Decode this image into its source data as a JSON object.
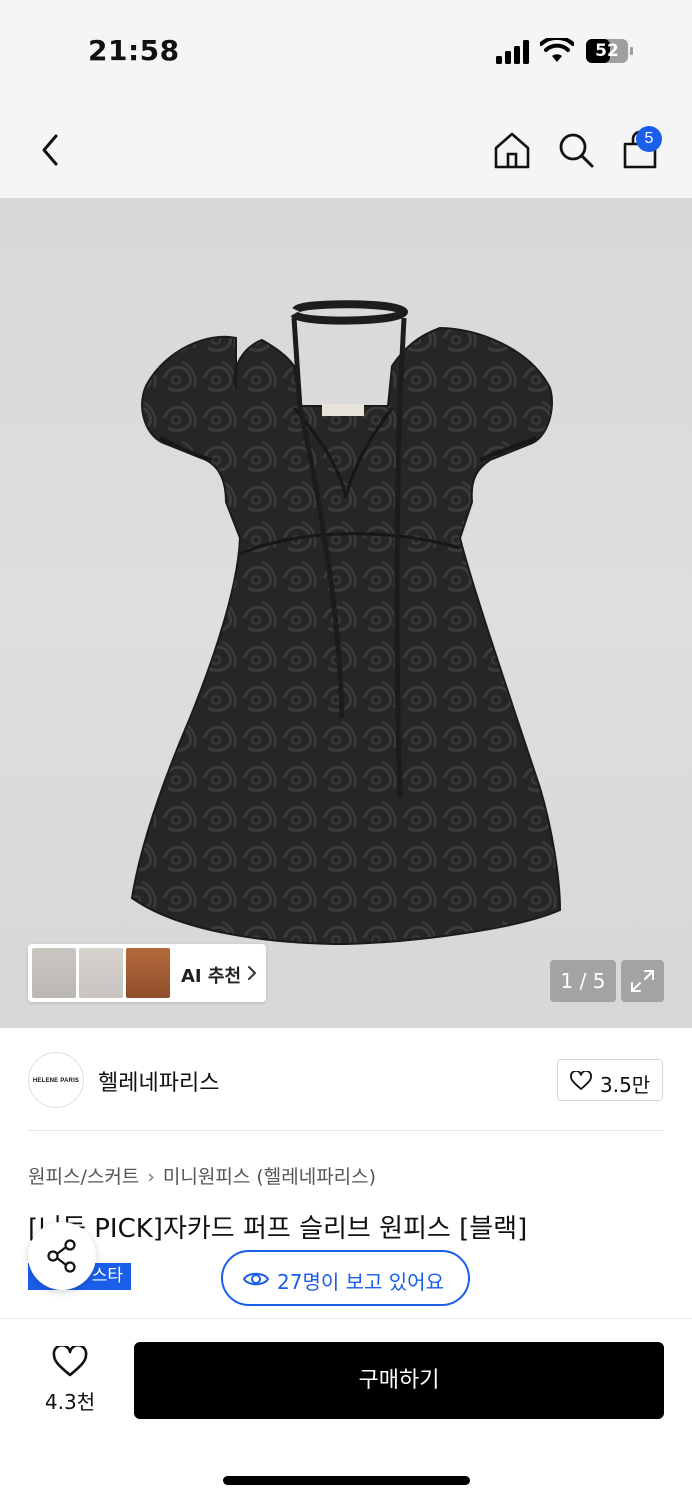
{
  "status_bar": {
    "time": "21:58",
    "battery": "52"
  },
  "header": {
    "icons": [
      "chevron-left-icon",
      "home-icon",
      "search-icon",
      "shopping-bag-icon"
    ],
    "cart_count": "5"
  },
  "gallery": {
    "ai_recommend_label": "AI 추천",
    "page_indicator": "1 / 5"
  },
  "brand": {
    "logo_text": "HELENE PARIS",
    "name": "헬레네파리스",
    "like_count": "3.5만"
  },
  "product": {
    "breadcrumb": [
      "원피스/스커트",
      "미니원피스 (헬레네파리스)"
    ],
    "title": "[니둥 PICK]자카드 퍼프 슬리브 원피스 [블랙]",
    "tag": "스타",
    "viewers_text": "27명이 보고 있어요"
  },
  "bottom_bar": {
    "wish_count": "4.3천",
    "buy_label": "구매하기"
  },
  "colors": {
    "accent": "#1a5eea",
    "buy_button": "#000000",
    "header_bg": "#f5f5f5"
  }
}
